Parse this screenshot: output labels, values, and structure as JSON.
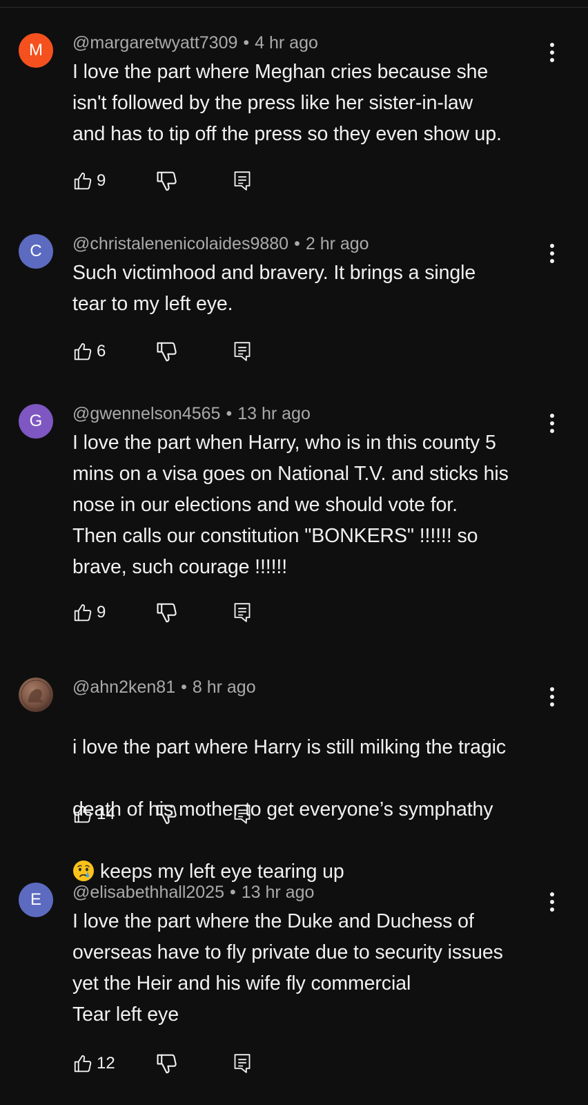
{
  "comments": [
    {
      "avatar_letter": "M",
      "avatar_color": "#f4511e",
      "handle": "@margaretwyatt7309",
      "separator": "•",
      "time": "4 hr ago",
      "text": "I love the part where Meghan cries because she\nisn't followed by the press like her sister-in-law\nand has to tip off the press so they even show up.",
      "likes": "9"
    },
    {
      "avatar_letter": "C",
      "avatar_color": "#5c6bc0",
      "handle": "@christalenenicolaides9880",
      "separator": "•",
      "time": "2 hr ago",
      "text": "Such victimhood and bravery. It brings a single\ntear to my left eye.",
      "likes": "6"
    },
    {
      "avatar_letter": "G",
      "avatar_color": "#7e57c2",
      "handle": "@gwennelson4565",
      "separator": "•",
      "time": "13 hr ago",
      "text": "I love the part when Harry, who is in this county 5\nmins on a visa goes on National T.V. and sticks his\nnose in our elections and  we should vote for.\nThen calls our constitution \"BONKERS\" !!!!!! so\nbrave,  such courage !!!!!!",
      "likes": "9"
    },
    {
      "avatar_letter": "",
      "avatar_color": "#6b4a3a",
      "handle": "@ahn2ken81",
      "separator": "•",
      "time": "8 hr ago",
      "text_line1": "i love the part where Harry is still milking the tragic",
      "text_line2": "death of his mother to get everyone’s symphathy",
      "text_line3": "keeps my left eye tearing up",
      "emoji_icon": "crying-face-emoji",
      "likes": "14"
    },
    {
      "avatar_letter": "E",
      "avatar_color": "#5c6bc0",
      "handle": "@elisabethhall2025",
      "separator": "•",
      "time": "13 hr ago",
      "text": "I love the part where the Duke and Duchess of\noverseas have to fly private due to security issues\nyet the Heir and his wife fly commercial\nTear left eye",
      "likes": "12"
    }
  ],
  "icons": {
    "like": "thumbs-up-icon",
    "dislike": "thumbs-down-icon",
    "reply": "reply-icon",
    "more": "more-vertical-icon"
  }
}
